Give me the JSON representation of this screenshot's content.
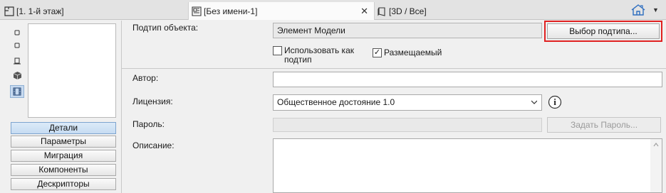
{
  "tabs": [
    {
      "label": "[1. 1-й этаж]",
      "icon": "floor-plan-icon"
    },
    {
      "label": "[Без имени-1]",
      "icon": "layout-icon",
      "close": "✕"
    },
    {
      "label": "[3D / Все]",
      "icon": "cube-3d-icon"
    }
  ],
  "home_menu": {
    "icon": "house-icon",
    "chevron": "▼"
  },
  "left_tools": [
    "object-icon",
    "object-outline-icon",
    "object-base-icon",
    "cube-icon",
    "filmstrip-icon"
  ],
  "side_buttons": [
    "Детали",
    "Параметры",
    "Миграция",
    "Компоненты",
    "Дескрипторы"
  ],
  "form": {
    "subtype_label": "Подтип объекта:",
    "subtype_value": "Элемент Модели",
    "subtype_button": "Выбор подтипа...",
    "use_as_subtype": "Использовать как подтип",
    "use_as_subtype_line1": "Использовать как",
    "use_as_subtype_line2": "подтип",
    "use_as_subtype_checked": false,
    "placeable": "Размещаемый",
    "placeable_checked": true,
    "author_label": "Автор:",
    "author_value": "",
    "license_label": "Лицензия:",
    "license_value": "Общественное достояние 1.0",
    "password_label": "Пароль:",
    "password_value": "",
    "set_password_button": "Задать Пароль...",
    "description_label": "Описание:",
    "description_value": "",
    "check_mark": "✓",
    "info_icon": "i"
  }
}
